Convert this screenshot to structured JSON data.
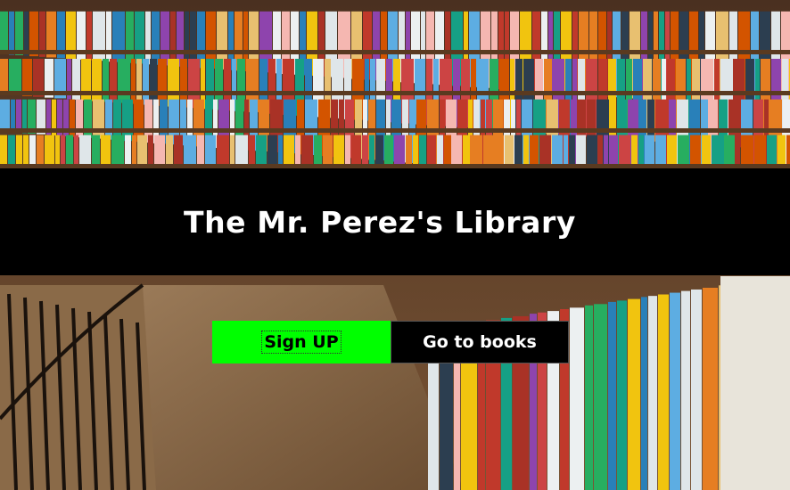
{
  "page": {
    "title": "The Mr. Perez's Library"
  },
  "actions": {
    "signup_label": "Sign UP",
    "books_label": "Go to books"
  },
  "colors": {
    "banner": "#000000",
    "signup_bg": "#00ff00",
    "books_bg": "#000000"
  },
  "background": {
    "icon": "library-bookshelves-photo"
  }
}
